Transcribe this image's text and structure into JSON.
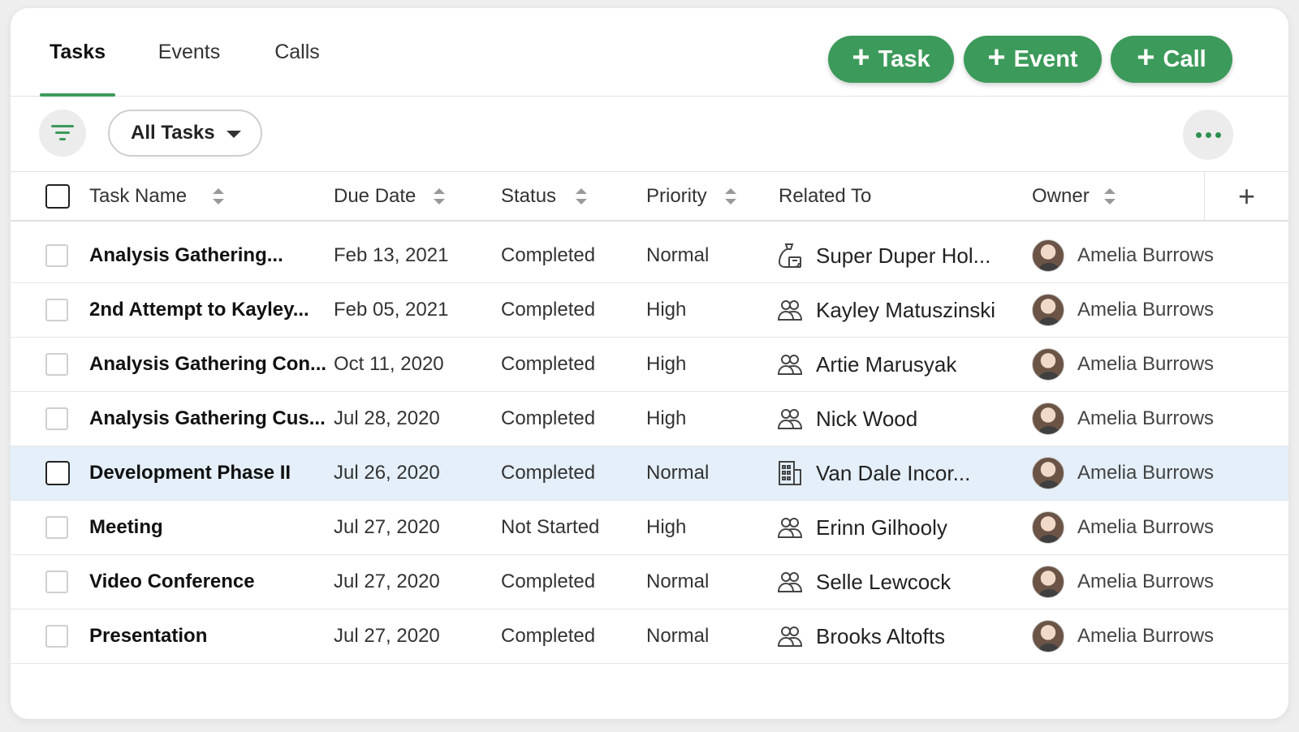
{
  "tabs": [
    {
      "label": "Tasks",
      "active": true
    },
    {
      "label": "Events",
      "active": false
    },
    {
      "label": "Calls",
      "active": false
    }
  ],
  "actions": {
    "add_task": "Task",
    "add_event": "Event",
    "add_call": "Call",
    "plus_symbol": "+"
  },
  "filter": {
    "view_label": "All Tasks",
    "filter_icon": "filter-icon",
    "more_icon": "more-horizontal-icon"
  },
  "columns": {
    "task_name": "Task Name",
    "due_date": "Due Date",
    "status": "Status",
    "priority": "Priority",
    "related_to": "Related To",
    "owner": "Owner",
    "add_column": "+"
  },
  "colors": {
    "accent": "#3c9a5a",
    "highlight_row": "#e4eff9"
  },
  "rows": [
    {
      "name": "Analysis Gathering...",
      "due": "Feb 13, 2021",
      "status": "Completed",
      "priority": "Normal",
      "related": "Super Duper Hol...",
      "related_icon": "deal-bag-icon",
      "owner": "Amelia Burrows",
      "highlighted": false
    },
    {
      "name": "2nd Attempt to Kayley...",
      "due": "Feb 05, 2021",
      "status": "Completed",
      "priority": "High",
      "related": "Kayley Matuszinski",
      "related_icon": "contact-icon",
      "owner": "Amelia Burrows",
      "highlighted": false
    },
    {
      "name": "Analysis Gathering Con...",
      "due": "Oct 11, 2020",
      "status": "Completed",
      "priority": "High",
      "related": "Artie Marusyak",
      "related_icon": "contact-icon",
      "owner": "Amelia Burrows",
      "highlighted": false
    },
    {
      "name": "Analysis Gathering Cus...",
      "due": "Jul 28, 2020",
      "status": "Completed",
      "priority": "High",
      "related": "Nick Wood",
      "related_icon": "contact-icon",
      "owner": "Amelia Burrows",
      "highlighted": false
    },
    {
      "name": "Development Phase II",
      "due": "Jul 26, 2020",
      "status": "Completed",
      "priority": "Normal",
      "related": "Van Dale Incor...",
      "related_icon": "building-icon",
      "owner": "Amelia Burrows",
      "highlighted": true
    },
    {
      "name": "Meeting",
      "due": "Jul 27, 2020",
      "status": "Not Started",
      "priority": "High",
      "related": "Erinn Gilhooly",
      "related_icon": "contact-icon",
      "owner": "Amelia Burrows",
      "highlighted": false
    },
    {
      "name": "Video Conference",
      "due": "Jul 27, 2020",
      "status": "Completed",
      "priority": "Normal",
      "related": "Selle Lewcock",
      "related_icon": "contact-icon",
      "owner": "Amelia Burrows",
      "highlighted": false
    },
    {
      "name": "Presentation",
      "due": "Jul 27, 2020",
      "status": "Completed",
      "priority": "Normal",
      "related": "Brooks Altofts",
      "related_icon": "contact-icon",
      "owner": "Amelia Burrows",
      "highlighted": false
    }
  ]
}
